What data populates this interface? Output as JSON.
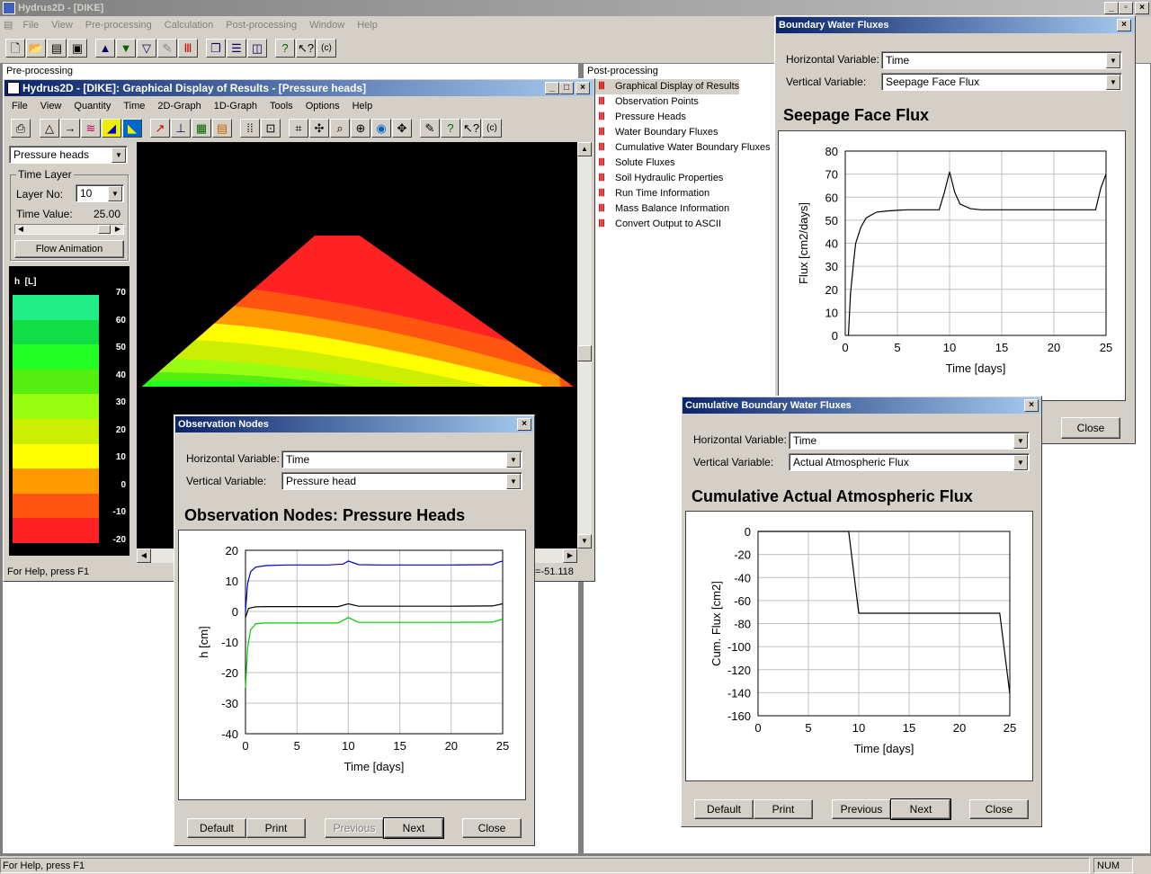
{
  "app": {
    "title": "Hydrus2D - [DIKE]",
    "menu": [
      "File",
      "View",
      "Pre-processing",
      "Calculation",
      "Post-processing",
      "Window",
      "Help"
    ],
    "status": "For Help, press F1",
    "status_num": "NUM"
  },
  "panes": {
    "pre_label": "Pre-processing",
    "post_label": "Post-processing",
    "post_items": [
      "Graphical Display of Results",
      "Observation Points",
      "Pressure Heads",
      "Water Boundary Fluxes",
      "Cumulative Water Boundary Fluxes",
      "Solute Fluxes",
      "Soil Hydraulic Properties",
      "Run Time Information",
      "Mass Balance Information",
      "Convert Output to ASCII"
    ]
  },
  "results_window": {
    "title": "Hydrus2D - [DIKE]: Graphical Display of Results - [Pressure heads]",
    "menu": [
      "File",
      "View",
      "Quantity",
      "Time",
      "2D-Graph",
      "1D-Graph",
      "Tools",
      "Options",
      "Help"
    ],
    "quantity_select": "Pressure heads",
    "time_layer_group": "Time Layer",
    "layer_label": "Layer No:",
    "layer_value": "10",
    "time_value_label": "Time Value:",
    "time_value": "25.00",
    "flow_animation": "Flow Animation",
    "legend_title": "h  [L]",
    "legend_ticks": [
      "70",
      "60",
      "50",
      "40",
      "30",
      "20",
      "10",
      "0",
      "-10",
      "-20"
    ],
    "legend_colors": [
      "#22ee88",
      "#11dd44",
      "#22ff22",
      "#55ee11",
      "#99ff11",
      "#ccee00",
      "#ffff00",
      "#ff9900",
      "#ff5511",
      "#ff2222"
    ],
    "status": "For Help, press F1",
    "coord_readout": "=-51.118"
  },
  "observation_dialog": {
    "title": "Observation Nodes",
    "hvar_label": "Horizontal Variable:",
    "hvar_value": "Time",
    "vvar_label": "Vertical Variable:",
    "vvar_value": "Pressure head",
    "heading": "Observation Nodes: Pressure Heads",
    "buttons": {
      "default": "Default",
      "print": "Print",
      "previous": "Previous",
      "next": "Next",
      "close": "Close"
    }
  },
  "boundary_dialog": {
    "title": "Boundary Water Fluxes",
    "hvar_label": "Horizontal Variable:",
    "hvar_value": "Time",
    "vvar_label": "Vertical Variable:",
    "vvar_value": "Seepage Face Flux",
    "heading": "Seepage Face Flux",
    "close": "Close"
  },
  "cumulative_dialog": {
    "title": "Cumulative Boundary Water Fluxes",
    "hvar_label": "Horizontal Variable:",
    "hvar_value": "Time",
    "vvar_label": "Vertical Variable:",
    "vvar_value": "Actual Atmospheric Flux",
    "heading": "Cumulative Actual Atmospheric Flux",
    "buttons": {
      "default": "Default",
      "print": "Print",
      "previous": "Previous",
      "next": "Next",
      "close": "Close"
    }
  },
  "chart_data": [
    {
      "id": "obs",
      "type": "line",
      "xlabel": "Time [days]",
      "ylabel": "h [cm]",
      "xlim": [
        0,
        25
      ],
      "ylim": [
        -40,
        20
      ],
      "xticks": [
        0,
        5,
        10,
        15,
        20,
        25
      ],
      "yticks": [
        20,
        10,
        0,
        -10,
        -20,
        -30,
        -40
      ],
      "grid": true,
      "series": [
        {
          "color": "#0000cc",
          "x": [
            0,
            0.2,
            0.5,
            1,
            2,
            4,
            8,
            9.5,
            10,
            11,
            13,
            20,
            24,
            24.5,
            25
          ],
          "y": [
            0,
            9,
            13,
            14.5,
            15,
            15.2,
            15.2,
            15.5,
            16.5,
            15.3,
            15.2,
            15.2,
            15.3,
            16,
            16.5
          ]
        },
        {
          "color": "#000000",
          "x": [
            0,
            0.3,
            1,
            2,
            5,
            9,
            10,
            11,
            20,
            24,
            25
          ],
          "y": [
            -2,
            1,
            1.5,
            1.6,
            1.6,
            1.6,
            2.5,
            1.7,
            1.7,
            1.8,
            2.5
          ]
        },
        {
          "color": "#00cc00",
          "x": [
            0,
            0.2,
            0.5,
            1,
            2,
            5,
            9,
            10,
            11,
            20,
            24,
            25
          ],
          "y": [
            -25,
            -12,
            -6,
            -4,
            -3.8,
            -3.8,
            -3.8,
            -2,
            -3.6,
            -3.6,
            -3.5,
            -2.5
          ]
        }
      ]
    },
    {
      "id": "seepage",
      "type": "line",
      "xlabel": "Time [days]",
      "ylabel": "Flux [cm2/days]",
      "xlim": [
        0,
        25
      ],
      "ylim": [
        0,
        80
      ],
      "xticks": [
        0,
        5,
        10,
        15,
        20,
        25
      ],
      "yticks": [
        80,
        70,
        60,
        50,
        40,
        30,
        20,
        10,
        0
      ],
      "grid": true,
      "series": [
        {
          "color": "#000000",
          "x": [
            0.3,
            0.5,
            0.8,
            1,
            1.5,
            2,
            3,
            4,
            5,
            6,
            9,
            9.5,
            10,
            10.5,
            11,
            12,
            13,
            20,
            24,
            24.5,
            25
          ],
          "y": [
            0,
            18,
            32,
            40,
            47,
            51,
            53.5,
            54,
            54.3,
            54.5,
            54.5,
            62,
            71,
            62,
            57,
            55,
            54.5,
            54.5,
            54.5,
            64,
            70
          ]
        }
      ]
    },
    {
      "id": "cumulative",
      "type": "line",
      "xlabel": "Time [days]",
      "ylabel": "Cum. Flux [cm2]",
      "xlim": [
        0,
        25
      ],
      "ylim": [
        -160,
        0
      ],
      "xticks": [
        0,
        5,
        10,
        15,
        20,
        25
      ],
      "yticks": [
        0,
        -20,
        -40,
        -60,
        -80,
        -100,
        -120,
        -140,
        -160
      ],
      "grid": true,
      "series": [
        {
          "color": "#000000",
          "x": [
            0,
            9,
            10,
            24,
            25
          ],
          "y": [
            0,
            0,
            -71,
            -71,
            -141
          ]
        }
      ]
    }
  ]
}
